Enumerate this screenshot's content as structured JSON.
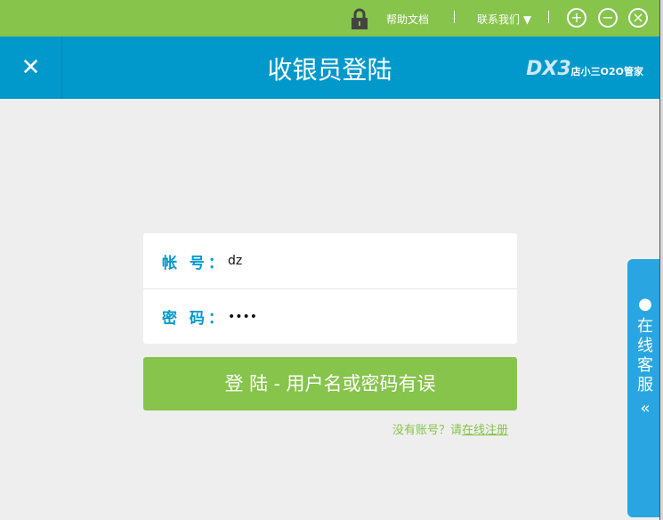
{
  "topbar": {
    "help": "帮助文档",
    "contact": "联系我们",
    "plus": "+",
    "minus": "−",
    "close": "×"
  },
  "header": {
    "close": "✕",
    "title": "收银员登陆",
    "logo_main": "DX3",
    "logo_sub": "店小三O2O管家"
  },
  "form": {
    "account_label": "帐 号：",
    "account_value": "dz",
    "password_label": "密 码：",
    "password_value": "••••"
  },
  "login_button": "登 陆 - 用户名或密码有误",
  "register": {
    "prompt": "没有账号？请",
    "link": "在线注册"
  },
  "side": {
    "label": "在线客服",
    "chevron": "«"
  }
}
